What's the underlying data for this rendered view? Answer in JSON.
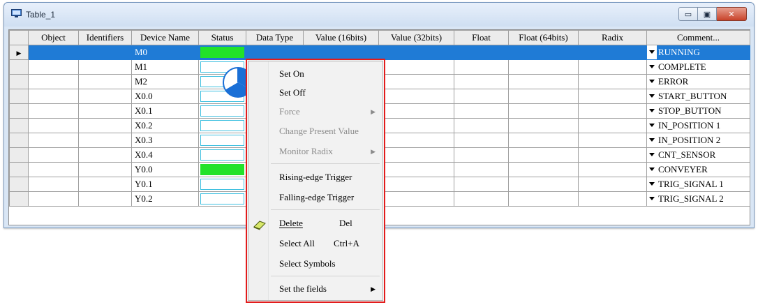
{
  "window": {
    "title": "Table_1",
    "buttons": {
      "minimize": "▭",
      "maximize": "▣",
      "close": "✕"
    }
  },
  "columns": [
    "",
    "Object",
    "Identifiers",
    "Device Name",
    "Status",
    "Data Type",
    "Value (16bits)",
    "Value (32bits)",
    "Float",
    "Float (64bits)",
    "Radix",
    "Comment..."
  ],
  "rows": [
    {
      "device": "M0",
      "status_on": true,
      "comment": "RUNNING",
      "selected": true,
      "marker": "▶"
    },
    {
      "device": "M1",
      "status_on": false,
      "comment": "COMPLETE"
    },
    {
      "device": "M2",
      "status_on": false,
      "comment": "ERROR"
    },
    {
      "device": "X0.0",
      "status_on": false,
      "comment": "START_BUTTON"
    },
    {
      "device": "X0.1",
      "status_on": false,
      "comment": "STOP_BUTTON"
    },
    {
      "device": "X0.2",
      "status_on": false,
      "comment": "IN_POSITION 1"
    },
    {
      "device": "X0.3",
      "status_on": false,
      "comment": "IN_POSITION 2"
    },
    {
      "device": "X0.4",
      "status_on": false,
      "comment": "CNT_SENSOR"
    },
    {
      "device": "Y0.0",
      "status_on": true,
      "comment": "CONVEYER"
    },
    {
      "device": "Y0.1",
      "status_on": false,
      "comment": "TRIG_SIGNAL 1"
    },
    {
      "device": "Y0.2",
      "status_on": false,
      "comment": "TRIG_SIGNAL 2"
    }
  ],
  "context_menu": {
    "set_on": "Set On",
    "set_off": "Set Off",
    "force": "Force",
    "change_present_value": "Change Present Value",
    "monitor_radix": "Monitor Radix",
    "rising_edge": "Rising-edge Trigger",
    "falling_edge": "Falling-edge Trigger",
    "delete": "Delete",
    "delete_shortcut": "Del",
    "select_all": "Select All",
    "select_all_shortcut": "Ctrl+A",
    "select_symbols": "Select Symbols",
    "set_fields": "Set the fields",
    "submenu_arrow": "▶"
  },
  "colors": {
    "selection": "#1f7bd6",
    "status_on": "#22e22a",
    "highlight_frame": "#e21c1c",
    "pie_cursor": "#1a6fd6"
  },
  "icons": [
    "window-app-icon",
    "eraser-icon",
    "wait-cursor-icon",
    "dropdown-arrow-icon",
    "row-marker-icon"
  ]
}
